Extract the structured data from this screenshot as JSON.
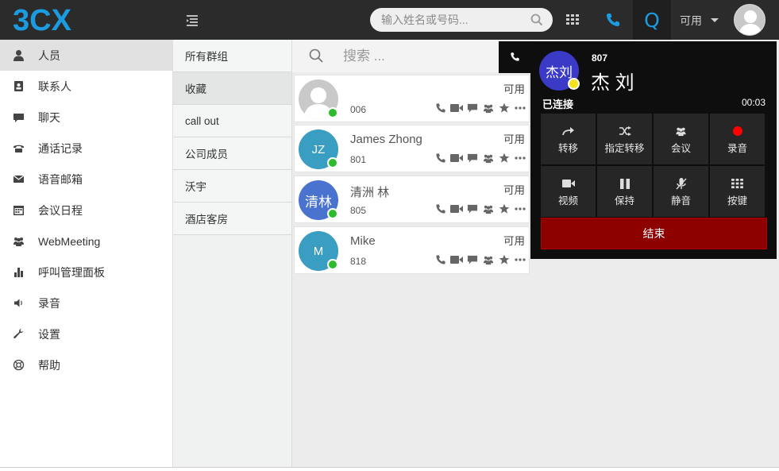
{
  "app": {
    "logo_text": "3CX"
  },
  "header": {
    "search_placeholder": "输入姓名或号码...",
    "quick_label": "Q",
    "status_label": "可用"
  },
  "sidebar": {
    "items": [
      {
        "label": "人员",
        "icon": "person-icon"
      },
      {
        "label": "联系人",
        "icon": "address-book-icon"
      },
      {
        "label": "聊天",
        "icon": "chat-icon"
      },
      {
        "label": "通话记录",
        "icon": "call-log-icon"
      },
      {
        "label": "语音邮箱",
        "icon": "envelope-icon"
      },
      {
        "label": "会议日程",
        "icon": "calendar-icon"
      },
      {
        "label": "WebMeeting",
        "icon": "group-icon"
      },
      {
        "label": "呼叫管理面板",
        "icon": "bar-chart-icon"
      },
      {
        "label": "录音",
        "icon": "volume-icon"
      },
      {
        "label": "设置",
        "icon": "wrench-icon"
      },
      {
        "label": "帮助",
        "icon": "lifebuoy-icon"
      }
    ]
  },
  "groups": {
    "items": [
      "所有群组",
      "收藏",
      "call out",
      "公司成员",
      "沃宇",
      "酒店客房"
    ]
  },
  "list": {
    "search_placeholder": "搜索 ...",
    "contacts": [
      {
        "initials": "",
        "name": "",
        "ext": "006",
        "status": "可用",
        "avatar_color": "#c9c9c9"
      },
      {
        "initials": "JZ",
        "name": "James Zhong",
        "ext": "801",
        "status": "可用",
        "avatar_color": "#3a9dc2"
      },
      {
        "initials": "清林",
        "name": "清洲 林",
        "ext": "805",
        "status": "可用",
        "avatar_color": "#4a73cf"
      },
      {
        "initials": "M",
        "name": "Mike",
        "ext": "818",
        "status": "可用",
        "avatar_color": "#3a9dc2"
      }
    ]
  },
  "call_panel": {
    "avatar_text": "杰刘",
    "ext": "807",
    "name": "杰 刘",
    "state": "已连接",
    "timer": "00:03",
    "buttons": [
      {
        "label": "转移",
        "icon": "transfer-icon"
      },
      {
        "label": "指定转移",
        "icon": "shuffle-icon"
      },
      {
        "label": "会议",
        "icon": "conference-icon"
      },
      {
        "label": "录音",
        "icon": "record-icon"
      },
      {
        "label": "视频",
        "icon": "video-icon"
      },
      {
        "label": "保持",
        "icon": "pause-icon"
      },
      {
        "label": "静音",
        "icon": "mute-icon"
      },
      {
        "label": "按键",
        "icon": "keypad-icon"
      }
    ],
    "end_label": "结束"
  },
  "colors": {
    "topbar": "#2b2b2b",
    "accent_blue": "#1c9be0",
    "available_green": "#2dba2d",
    "end_call_red": "#8c0000",
    "record_dot": "#ff0000",
    "away_yellow": "#f4e21c"
  }
}
